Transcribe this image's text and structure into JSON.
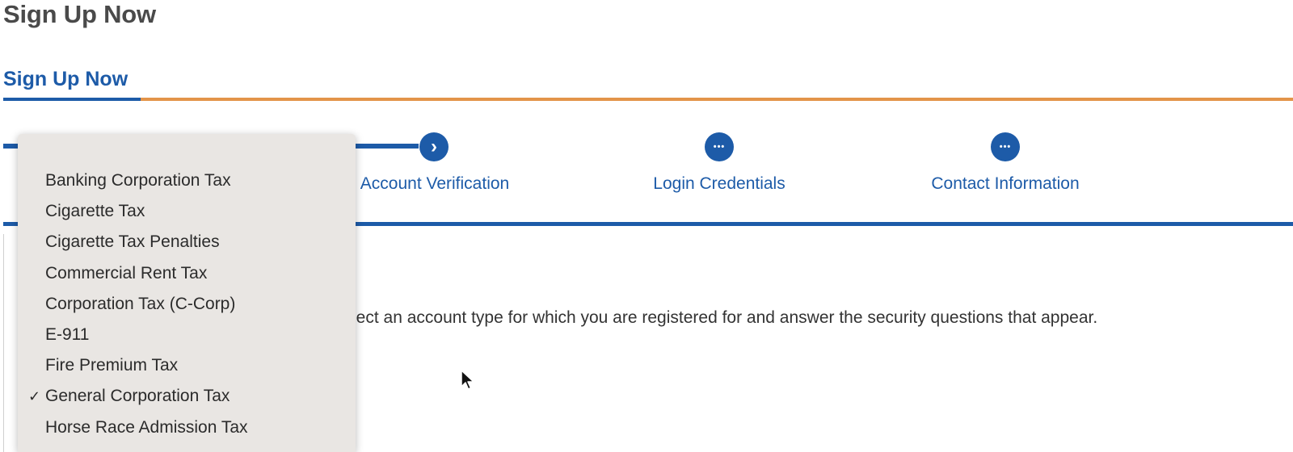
{
  "page": {
    "heading": "Sign Up Now"
  },
  "tabs": [
    {
      "label": "Sign Up Now",
      "active": true
    }
  ],
  "stepper": {
    "steps": [
      {
        "label": "Account Verification",
        "icon": "chevron-right-icon"
      },
      {
        "label": "Login Credentials",
        "icon": "ellipsis-icon"
      },
      {
        "label": "Contact Information",
        "icon": "ellipsis-icon"
      }
    ]
  },
  "instruction": {
    "text": "lect an account type for which you are registered for and answer the security questions that appear."
  },
  "dropdown": {
    "selected": "General Corporation Tax",
    "options": [
      "Banking Corporation Tax",
      "Cigarette Tax",
      "Cigarette Tax Penalties",
      "Commercial Rent Tax",
      "Corporation Tax (C-Corp)",
      "E-911",
      "Fire Premium Tax",
      "General Corporation Tax",
      "Horse Race Admission Tax"
    ]
  },
  "icons": {
    "step_next": "›",
    "step_pending": "•••",
    "check": "✓"
  },
  "colors": {
    "primary_blue": "#1d5ba8",
    "accent_orange": "#e39449",
    "dropdown_bg": "#e9e6e3",
    "heading_gray": "#4a4a4a"
  }
}
